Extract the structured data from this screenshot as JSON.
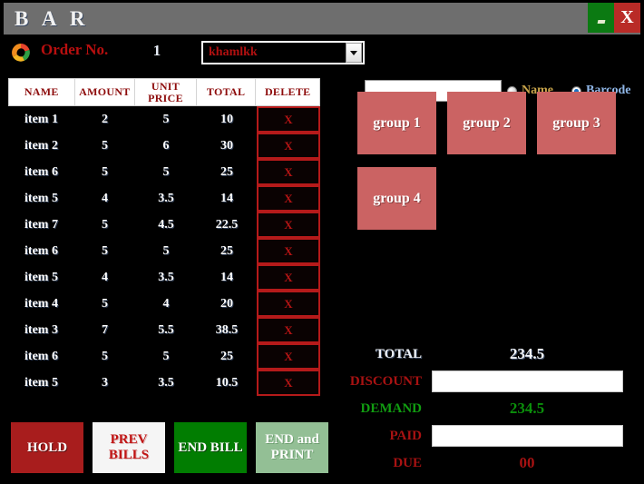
{
  "window": {
    "title": "B A R",
    "minimize_label": "",
    "close_label": "X"
  },
  "toolbar": {
    "logo_icon": "swirl-logo-icon",
    "order_label": "Order No.",
    "order_value": "1",
    "customer_value": "khamlkk",
    "dropdown_icon": "chevron-down-icon",
    "search_value": "",
    "search_placeholder": "",
    "radio_name_label": "Name",
    "radio_barcode_label": "Barcode",
    "radio_selected": "Barcode"
  },
  "items_table": {
    "columns": [
      "NAME",
      "AMOUNT",
      "UNIT PRICE",
      "TOTAL",
      "DELETE"
    ],
    "delete_label": "X",
    "rows": [
      {
        "name": "item 1",
        "amount": "2",
        "price": "5",
        "total": "10"
      },
      {
        "name": "item 2",
        "amount": "5",
        "price": "6",
        "total": "30"
      },
      {
        "name": "item 6",
        "amount": "5",
        "price": "5",
        "total": "25"
      },
      {
        "name": "item 5",
        "amount": "4",
        "price": "3.5",
        "total": "14"
      },
      {
        "name": "item 7",
        "amount": "5",
        "price": "4.5",
        "total": "22.5"
      },
      {
        "name": "item 6",
        "amount": "5",
        "price": "5",
        "total": "25"
      },
      {
        "name": "item 5",
        "amount": "4",
        "price": "3.5",
        "total": "14"
      },
      {
        "name": "item 4",
        "amount": "5",
        "price": "4",
        "total": "20"
      },
      {
        "name": "item 3",
        "amount": "7",
        "price": "5.5",
        "total": "38.5"
      },
      {
        "name": "item 6",
        "amount": "5",
        "price": "5",
        "total": "25"
      },
      {
        "name": "item 5",
        "amount": "3",
        "price": "3.5",
        "total": "10.5"
      }
    ]
  },
  "actions": {
    "hold": "HOLD",
    "prev_bills": "PREV BILLS",
    "end_bill": "END BILL",
    "end_and_print": "END and PRINT"
  },
  "groups": [
    {
      "label": "group 1"
    },
    {
      "label": "group 2"
    },
    {
      "label": "group 3"
    },
    {
      "label": "group 4"
    }
  ],
  "totals": {
    "total_label": "TOTAL",
    "total_value": "234.5",
    "discount_label": "DISCOUNT",
    "discount_value": "",
    "demand_label": "DEMAND",
    "demand_value": "234.5",
    "paid_label": "PAID",
    "paid_value": "",
    "due_label": "DUE",
    "due_value": "00"
  },
  "colors": {
    "titlebar": "#6e6e6e",
    "background": "#000000",
    "accent_red": "#b01010",
    "group_button": "#cb6363",
    "green": "#017d01",
    "close_red": "#b92b27"
  }
}
